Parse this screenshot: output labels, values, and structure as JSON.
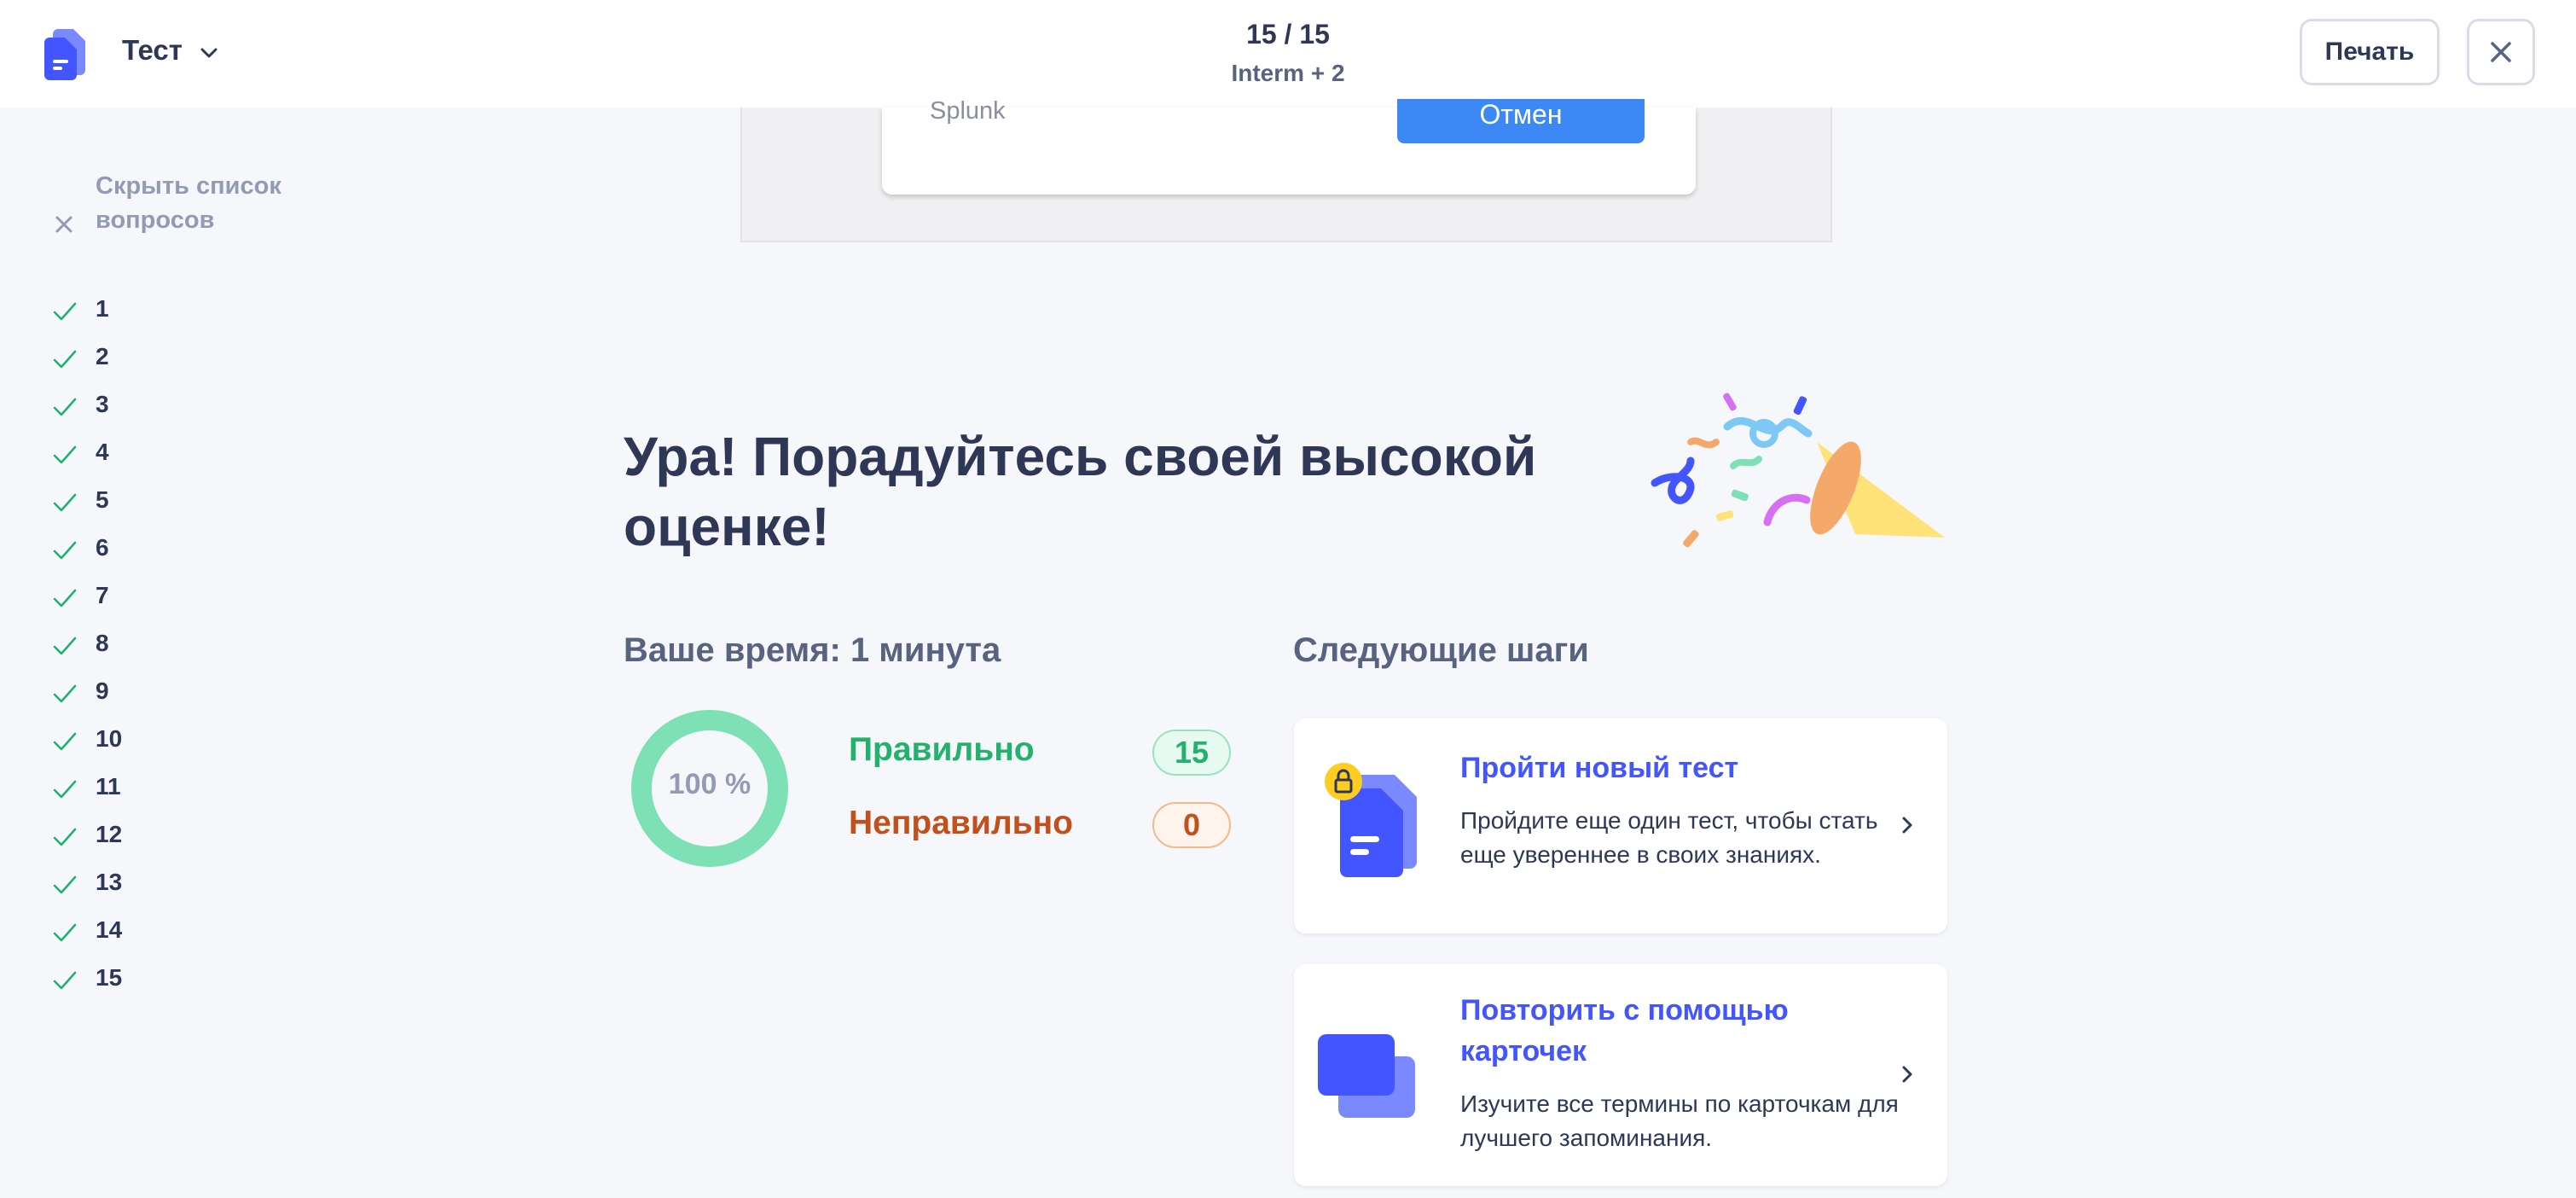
{
  "header": {
    "mode_title": "Тест",
    "progress_count": "15 / 15",
    "progress_subtitle": "Interm + 2",
    "print_label": "Печать"
  },
  "sidebar": {
    "hide_label": "Скрыть список вопросов",
    "questions": [
      "1",
      "2",
      "3",
      "4",
      "5",
      "6",
      "7",
      "8",
      "9",
      "10",
      "11",
      "12",
      "13",
      "14",
      "15"
    ]
  },
  "previous_question": {
    "answer_text": "Splunk",
    "button_label": "Отмен"
  },
  "result": {
    "headline": "Ура! Порадуйтесь своей высокой оценке!",
    "time_text": "Ваше время: 1 минута",
    "score_percent_text": "100 %",
    "score_fraction": 1.0,
    "correct_label": "Правильно",
    "correct_count": "15",
    "wrong_label": "Неправильно",
    "wrong_count": "0"
  },
  "next_steps": {
    "title": "Следующие шаги",
    "cards": [
      {
        "title": "Пройти новый тест",
        "description": "Пройдите еще один тест, чтобы стать еще увереннее в своих знаниях."
      },
      {
        "title": "Повторить с помощью карточек",
        "description": "Изучите все термины по карточкам для лучшего запоминания."
      }
    ]
  },
  "colors": {
    "accent": "#4255ff",
    "correct": "#23b26d",
    "wrong": "#c2501c",
    "donut": "#7ee0b5",
    "background": "#f6f7fb"
  },
  "icons": {
    "logo": "quizlet-test-logo-icon",
    "mode_chevron": "chevron-down-icon",
    "close": "close-icon",
    "hide_list": "close-icon",
    "question_check": "check-icon",
    "confetti": "party-popper-icon",
    "test_card": "locked-test-icon",
    "flashcards_card": "flashcards-icon",
    "card_chevron": "chevron-right-icon"
  }
}
